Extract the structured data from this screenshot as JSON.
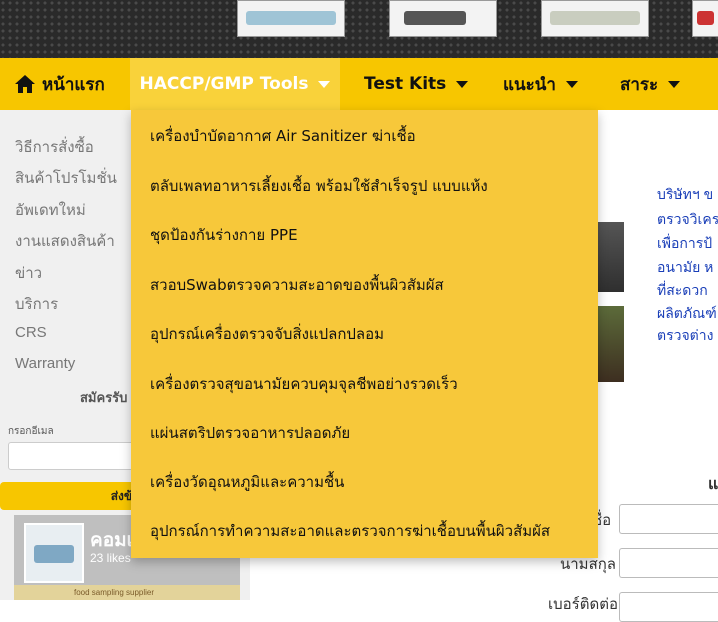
{
  "nav": {
    "home": "หน้าแรก",
    "haccp": "HACCP/GMP Tools",
    "test_kits": "Test Kits",
    "advice": "แนะนำ",
    "content": "สาระ"
  },
  "dropdown": {
    "items": [
      "เครื่องบำบัดอากาศ Air Sanitizer ฆ่าเชื้อ",
      "ตลับเพลทอาหารเลี้ยงเชื้อ พร้อมใช้สำเร็จรูป แบบแห้ง",
      "ชุดป้องกันร่างกาย PPE",
      "สวอบSwabตรวจความสะอาดของพื้นผิวสัมผัส",
      "อุปกรณ์เครื่องตรวจจับสิ่งแปลกปลอม",
      "เครื่องตรวจสุขอนามัยควบคุมจุลชีพอย่างรวดเร็ว",
      "แผ่นสตริปตรวจอาหารปลอดภัย",
      "เครื่องวัดอุณหภูมิและความชื้น",
      "อุปกรณ์การทำความสะอาดและตรวจการฆ่าเชื้อบนพื้นผิวสัมผัส"
    ]
  },
  "sidebar": {
    "items": [
      "วิธีการสั่งซื้อ",
      "สินค้าโปรโมชั่น",
      "อัพเดทใหม่",
      "งานแสดงสินค้า",
      "ข่าว",
      "บริการ",
      "CRS",
      "Warranty"
    ],
    "subscribe_title": "สมัครรับ",
    "email_label": "กรอกอีเมล",
    "send_button": "ส่งข้อ"
  },
  "facebook": {
    "name": "คอมเ",
    "likes": "23 likes",
    "banner": "food sampling supplier"
  },
  "main": {
    "blue_lines": [
      "บริษัทฯ ข",
      "ตรวจวิเคร",
      "เพื่อการป้",
      "อนามัย ห",
      "ที่สะดวก",
      "ผลิตภัณฑ์",
      "ตรวจต่าง"
    ],
    "heading_cut": "แ",
    "form_labels": [
      "ชื่อ",
      "นามสกุล",
      "เบอร์ติดต่อ"
    ]
  }
}
